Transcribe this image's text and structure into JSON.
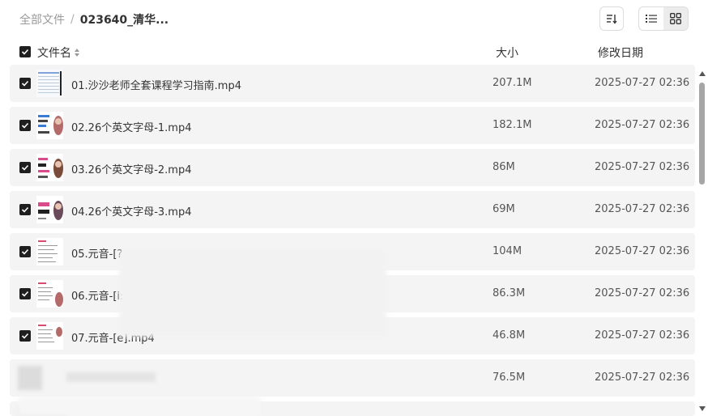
{
  "breadcrumb": {
    "root": "全部文件",
    "separator": "/",
    "current": "023640_清华..."
  },
  "header": {
    "name": "文件名",
    "size": "大小",
    "date": "修改日期"
  },
  "files": [
    {
      "name": "01.沙沙老师全套课程学习指南.mp4",
      "size": "207.1M",
      "date": "2025-07-27 02:36",
      "checked": true
    },
    {
      "name": "02.26个英文字母-1.mp4",
      "size": "182.1M",
      "date": "2025-07-27 02:36",
      "checked": true
    },
    {
      "name": "03.26个英文字母-2.mp4",
      "size": "86M",
      "date": "2025-07-27 02:36",
      "checked": true
    },
    {
      "name": "04.26个英文字母-3.mp4",
      "size": "69M",
      "date": "2025-07-27 02:36",
      "checked": true
    },
    {
      "name": "05.元音-[?",
      "size": "104M",
      "date": "2025-07-27 02:36",
      "checked": true
    },
    {
      "name": "06.元音-[i:",
      "size": "86.3M",
      "date": "2025-07-27 02:36",
      "checked": true
    },
    {
      "name": "07.元音-[e].mp4",
      "size": "46.8M",
      "date": "2025-07-27 02:36",
      "checked": true
    },
    {
      "name": "",
      "size": "76.5M",
      "date": "2025-07-27 02:36",
      "checked": false
    }
  ],
  "icons": {
    "sort": "sort-icon",
    "list_view": "list-view-icon",
    "grid_view": "grid-view-icon",
    "checkbox": "checkbox-checked-icon",
    "sort_column": "sort-arrows-icon"
  },
  "colors": {
    "row_bg": "#f4f4f4",
    "checkbox": "#1f1f1f",
    "active_view": "#ececec"
  }
}
